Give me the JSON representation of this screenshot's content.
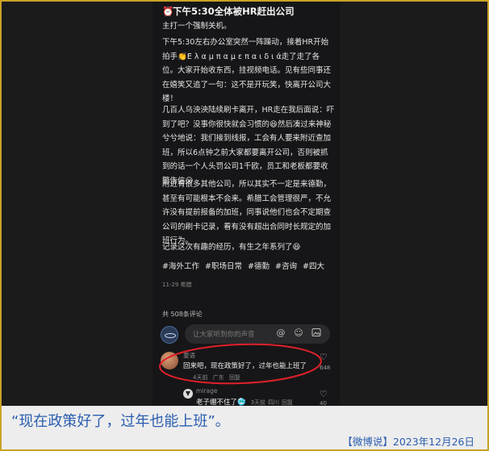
{
  "post": {
    "title": "下午5:30全体被HR赶出公司",
    "paragraphs": [
      "主打一个强制关机。",
      "下午5:30左右办公室突然一阵躁动，接着HR开始拍手👏Ε λ α μ π α μ ε π α ι δ ι ά走了走了各位。大家开始收东西，挂视频电话。见有些同事还在嬉笑又追了一句：这不是开玩笑，快离开公司大楼！",
      "几百人乌泱泱陆续刷卡离开，HR走在我后面说：吓到了吧？没事你很快就会习惯的😆然后凑过来神秘兮兮地说：我们接到线报，工会有人要来附近查加班，所以6点钟之前大家都要离开公司，否则被抓到的话一个人头罚公司1千欧，员工和老板都要收警告信😮",
      "附近有很多其他公司，所以其实不一定是来德勤，甚至有可能根本不会来。希腊工会管理很严，不允许没有提前报备的加班，同事说他们也会不定期查公司的刷卡记录，看有没有超出合同时长规定的加班行为。",
      "记录这次有趣的经历，有生之年系列了😆"
    ],
    "tags": [
      "#海外工作",
      "#职场日常",
      "#德勤",
      "#咨询",
      "#四大"
    ],
    "date": "11-29 希腊"
  },
  "comments": {
    "count_label": "共 508条评论",
    "input_placeholder": "让大家听到你的声音",
    "items": [
      {
        "name": "童语",
        "text": "回来吧，现在政策好了，过年也能上班了",
        "time": "4天前",
        "location": "广东",
        "reply": "回复",
        "likes": "648"
      },
      {
        "name": "mirage",
        "text": "老子绷不住了🥶",
        "time": "3天前",
        "location": "四川",
        "reply": "回复",
        "likes": "40"
      }
    ]
  },
  "caption": "“现在政策好了，过年也能上班”。",
  "source": "【微博说】2023年12月26日",
  "colors": {
    "caption_text": "#2a5db0",
    "frame_border": "#c9a227",
    "highlight_ellipse": "#e0202a"
  },
  "icons": [
    "alarm-clock-icon",
    "at-icon",
    "smile-icon",
    "image-icon",
    "heart-icon"
  ]
}
